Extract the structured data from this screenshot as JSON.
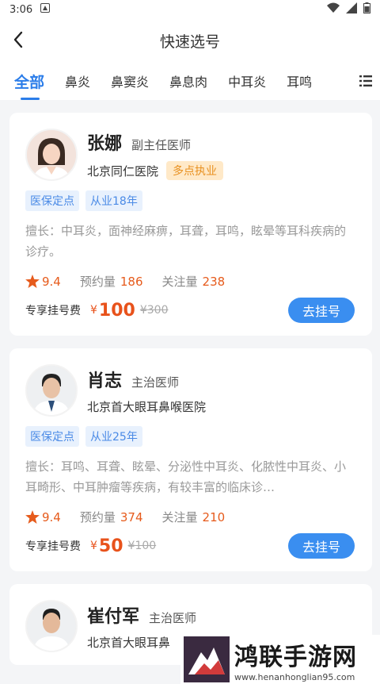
{
  "status": {
    "time": "3:06"
  },
  "header": {
    "title": "快速选号"
  },
  "tabs": [
    "全部",
    "鼻炎",
    "鼻窦炎",
    "鼻息肉",
    "中耳炎",
    "耳鸣"
  ],
  "doctors": [
    {
      "name": "张娜",
      "title": "副主任医师",
      "hospital": "北京同仁医院",
      "badge": "多点执业",
      "tags": [
        "医保定点",
        "从业18年"
      ],
      "desc": "擅长：中耳炎，面神经麻痹，耳聋，耳鸣，眩晕等耳科疾病的诊疗。",
      "rating": "9.4",
      "booking_label": "预约量",
      "booking": "186",
      "follow_label": "关注量",
      "follow": "238",
      "fee_label": "专享挂号费",
      "yen": "¥",
      "price": "100",
      "orig_price": "¥300",
      "button": "去挂号"
    },
    {
      "name": "肖志",
      "title": "主治医师",
      "hospital": "北京首大眼耳鼻喉医院",
      "tags": [
        "医保定点",
        "从业25年"
      ],
      "desc": "擅长：耳鸣、耳聋、眩晕、分泌性中耳炎、化脓性中耳炎、小耳畸形、中耳肿瘤等疾病，有较丰富的临床诊…",
      "rating": "9.4",
      "booking_label": "预约量",
      "booking": "374",
      "follow_label": "关注量",
      "follow": "210",
      "fee_label": "专享挂号费",
      "yen": "¥",
      "price": "50",
      "orig_price": "¥100",
      "button": "去挂号"
    },
    {
      "name": "崔付军",
      "title": "主治医师",
      "hospital": "北京首大眼耳鼻"
    }
  ],
  "watermark": {
    "main": "鸿联手游网",
    "sub": "www.henanhonglian95.com"
  },
  "colors": {
    "accent": "#2b7de9",
    "price": "#e8521b",
    "tag_bg": "#e8f1fd"
  }
}
